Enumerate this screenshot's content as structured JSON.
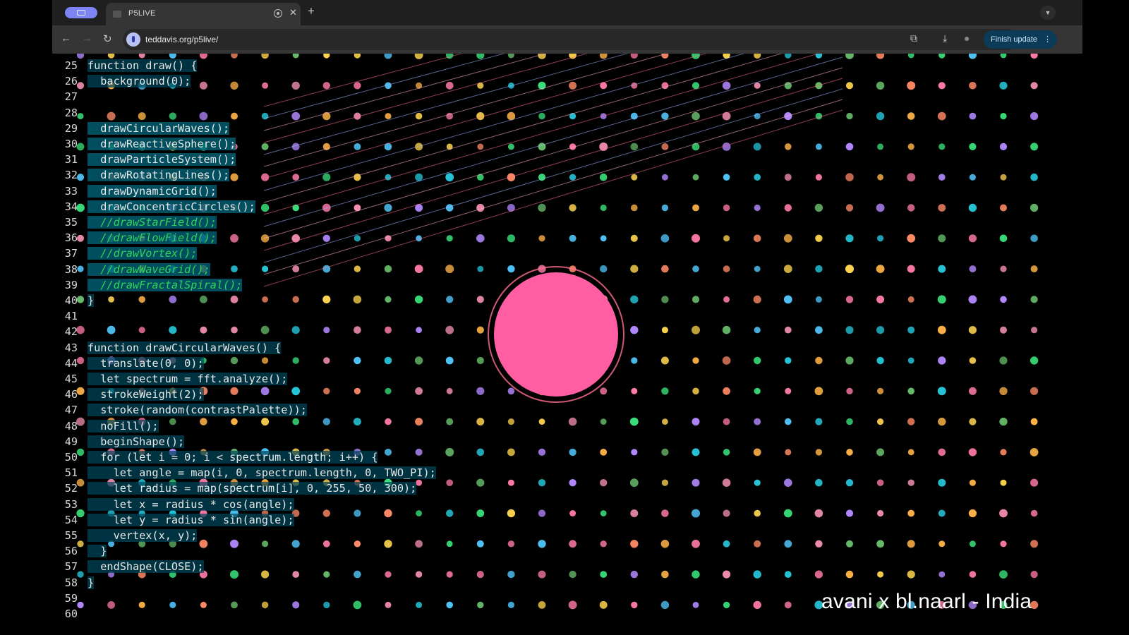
{
  "browser": {
    "tab": {
      "title": "P5LIVE"
    },
    "address": {
      "url": "teddavis.org/p5live/"
    },
    "update_button": {
      "label": "Finish update"
    }
  },
  "icons": {
    "back": "arrow-left-icon",
    "forward": "arrow-right-icon",
    "reload": "reload-icon",
    "bookmark": "star-icon",
    "extensions": "extensions-icon",
    "download": "download-icon"
  },
  "editor": {
    "lines": [
      {
        "num": "25",
        "text": "function draw() {"
      },
      {
        "num": "26",
        "text": "  background(0);"
      },
      {
        "num": "27",
        "text": ""
      },
      {
        "num": "28",
        "text": ""
      },
      {
        "num": "29",
        "text": "  drawCircularWaves();"
      },
      {
        "num": "30",
        "text": "  drawReactiveSphere();"
      },
      {
        "num": "31",
        "text": "  drawParticleSystem();"
      },
      {
        "num": "32",
        "text": "  drawRotatingLines();"
      },
      {
        "num": "33",
        "text": "  drawDynamicGrid();"
      },
      {
        "num": "34",
        "text": "  drawConcentricCircles();"
      },
      {
        "num": "35",
        "text": "  //drawStarField();"
      },
      {
        "num": "36",
        "text": "  //drawFlowField();"
      },
      {
        "num": "37",
        "text": "  //drawVortex();"
      },
      {
        "num": "38",
        "text": "  //drawWaveGrid();"
      },
      {
        "num": "39",
        "text": "  //drawFractalSpiral();"
      },
      {
        "num": "40",
        "text": "}"
      },
      {
        "num": "41",
        "text": ""
      },
      {
        "num": "42",
        "text": ""
      },
      {
        "num": "43",
        "text": "function drawCircularWaves() {"
      },
      {
        "num": "44",
        "text": "  translate(0, 0);"
      },
      {
        "num": "45",
        "text": "  let spectrum = fft.analyze();"
      },
      {
        "num": "46",
        "text": "  strokeWeight(2);"
      },
      {
        "num": "47",
        "text": "  stroke(random(contrastPalette));"
      },
      {
        "num": "48",
        "text": "  noFill();"
      },
      {
        "num": "49",
        "text": "  beginShape();"
      },
      {
        "num": "50",
        "text": "  for (let i = 0; i < spectrum.length; i++) {"
      },
      {
        "num": "51",
        "text": "    let angle = map(i, 0, spectrum.length, 0, TWO_PI);"
      },
      {
        "num": "52",
        "text": "    let radius = map(spectrum[i], 0, 255, 50, 300);"
      },
      {
        "num": "53",
        "text": "    let x = radius * cos(angle);"
      },
      {
        "num": "54",
        "text": "    let y = radius * sin(angle);"
      },
      {
        "num": "55",
        "text": "    vertex(x, y);"
      },
      {
        "num": "56",
        "text": "  }"
      },
      {
        "num": "57",
        "text": "  endShape(CLOSE);"
      },
      {
        "num": "58",
        "text": "}"
      },
      {
        "num": "59",
        "text": ""
      },
      {
        "num": "60",
        "text": ""
      }
    ]
  },
  "visuals": {
    "sphere_color": "#ff5fa2",
    "palette": [
      "#ff7aa8",
      "#ffb347",
      "#4fc3f7",
      "#39e07a",
      "#ffd54f",
      "#b388ff",
      "#ff8a65",
      "#26c6da",
      "#f48fb1",
      "#66bb6a"
    ]
  },
  "overlay": {
    "caption": "avani x bl.naarl - India"
  }
}
